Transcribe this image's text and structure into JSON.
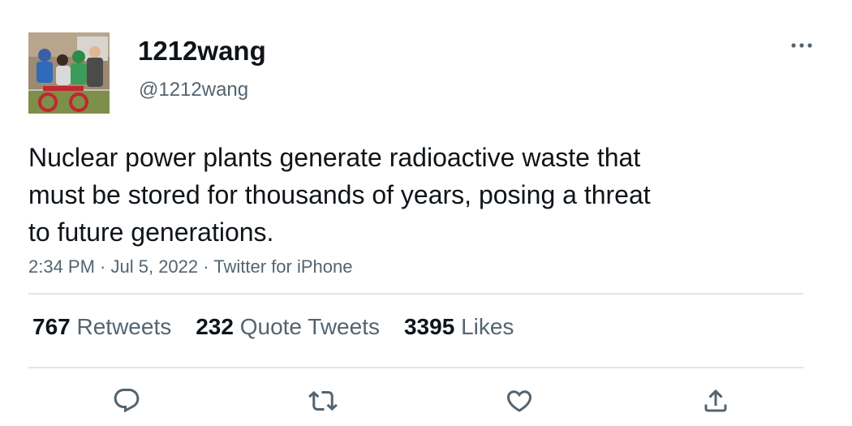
{
  "user": {
    "display_name": "1212wang",
    "handle": "@1212wang"
  },
  "tweet": {
    "text": "Nuclear power plants generate radioactive waste that\nmust be stored for thousands of years, posing a threat\nto future generations.",
    "time": "2:34 PM",
    "separator": " · ",
    "date": "Jul 5, 2022",
    "source": "Twitter for iPhone"
  },
  "stats": {
    "retweets": {
      "count": "767",
      "label": "Retweets"
    },
    "quote_tweets": {
      "count": "232",
      "label": "Quote Tweets"
    },
    "likes": {
      "count": "3395",
      "label": "Likes"
    }
  },
  "icons": {
    "more": "more-horizontal-icon",
    "reply": "reply-icon",
    "retweet": "retweet-icon",
    "like": "heart-icon",
    "share": "share-icon"
  },
  "colors": {
    "text": "#0f1419",
    "secondary": "#536471",
    "divider": "#e1e4e7"
  }
}
